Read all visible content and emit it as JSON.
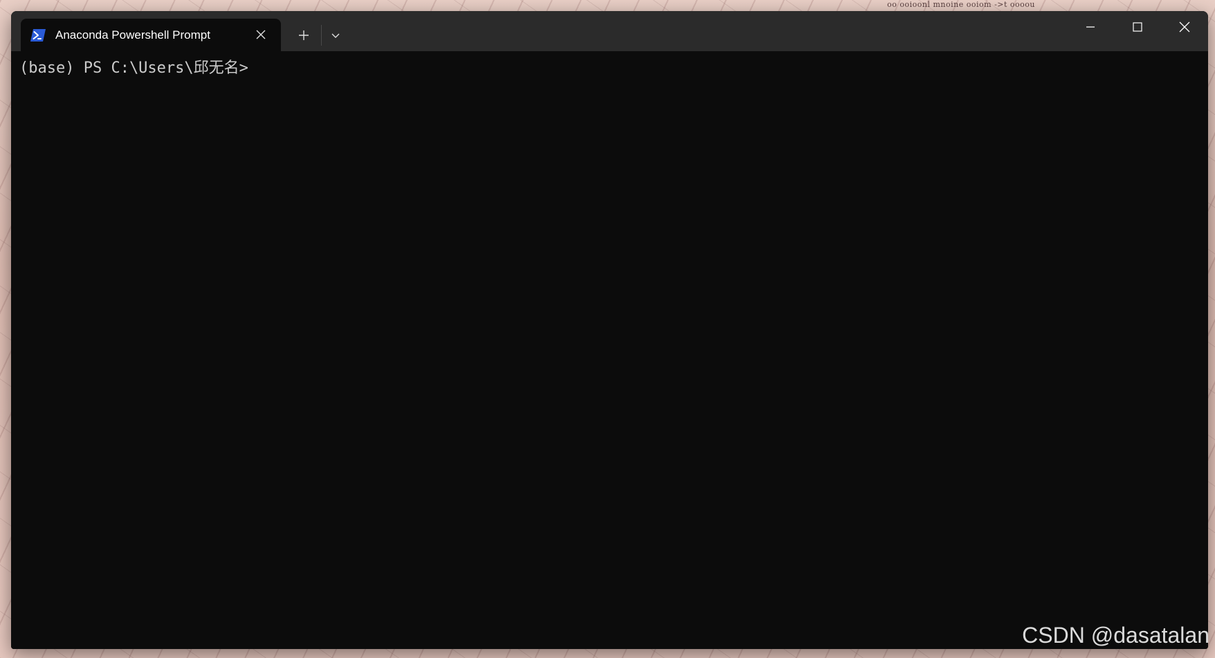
{
  "wallpaper": {
    "print_text": "oo ooioonl mnoine ooiom ->t oooou"
  },
  "window": {
    "tab": {
      "title": "Anaconda Powershell Prompt",
      "icon": "powershell-icon",
      "close_icon": "close-icon"
    },
    "new_tab_icon": "plus-icon",
    "dropdown_icon": "chevron-down-icon",
    "controls": {
      "minimize_icon": "minimize-icon",
      "maximize_icon": "maximize-icon",
      "close_icon": "close-icon"
    }
  },
  "terminal": {
    "prompt": "(base) PS C:\\Users\\邱无名>"
  },
  "watermark": "CSDN @dasatalan",
  "colors": {
    "titlebar": "#2b2b2b",
    "terminal_bg": "#0c0c0c",
    "terminal_fg": "#cccccc",
    "powershell_blue": "#2a5bd7"
  }
}
